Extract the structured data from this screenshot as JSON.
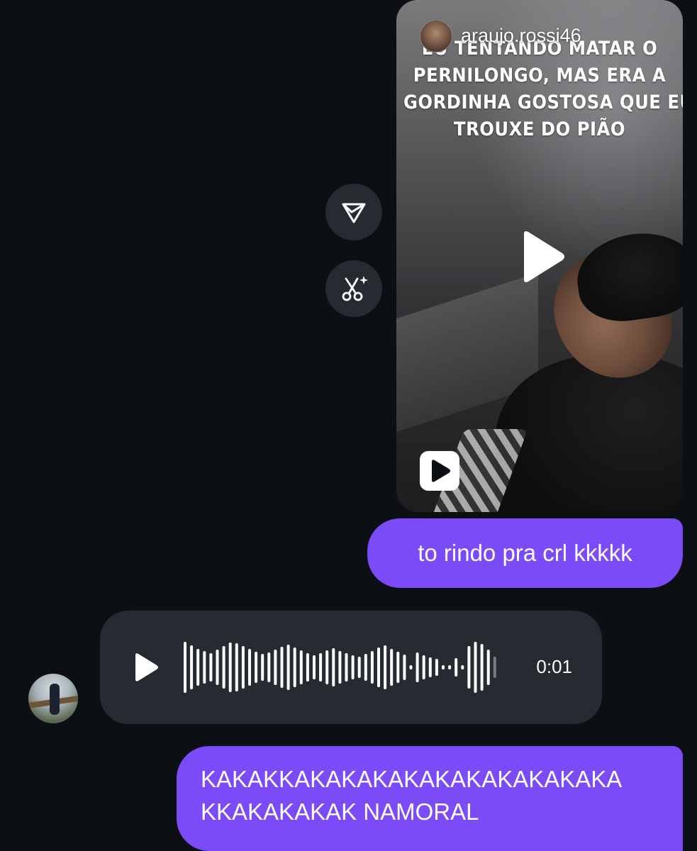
{
  "reel": {
    "username": "araujo.rossi46",
    "caption_lines": [
      "EU TENTANDO MATAR O",
      "PERNILONGO, MAS ERA A",
      "GORDINHA GOSTOSA QUE EU",
      "TROUXE DO PIÃO"
    ],
    "center_icon": "play-icon",
    "type_badge_icon": "reels-icon"
  },
  "actions": {
    "share_icon": "share-icon",
    "ai_icon": "ai-scissors-icon"
  },
  "messages": {
    "sent_1": "to rindo pra crl kkkkk",
    "voice": {
      "duration": "0:01",
      "play_icon": "play-icon"
    },
    "sent_2_lines": [
      "KAKAKKAKAKAKAKAKAKAKAKAKAKA",
      "KKAKAKAKAK NAMORAL"
    ]
  },
  "colors": {
    "background": "#0c1014",
    "sent_bubble": "#7a4bf6",
    "received_bubble": "#262a31"
  }
}
